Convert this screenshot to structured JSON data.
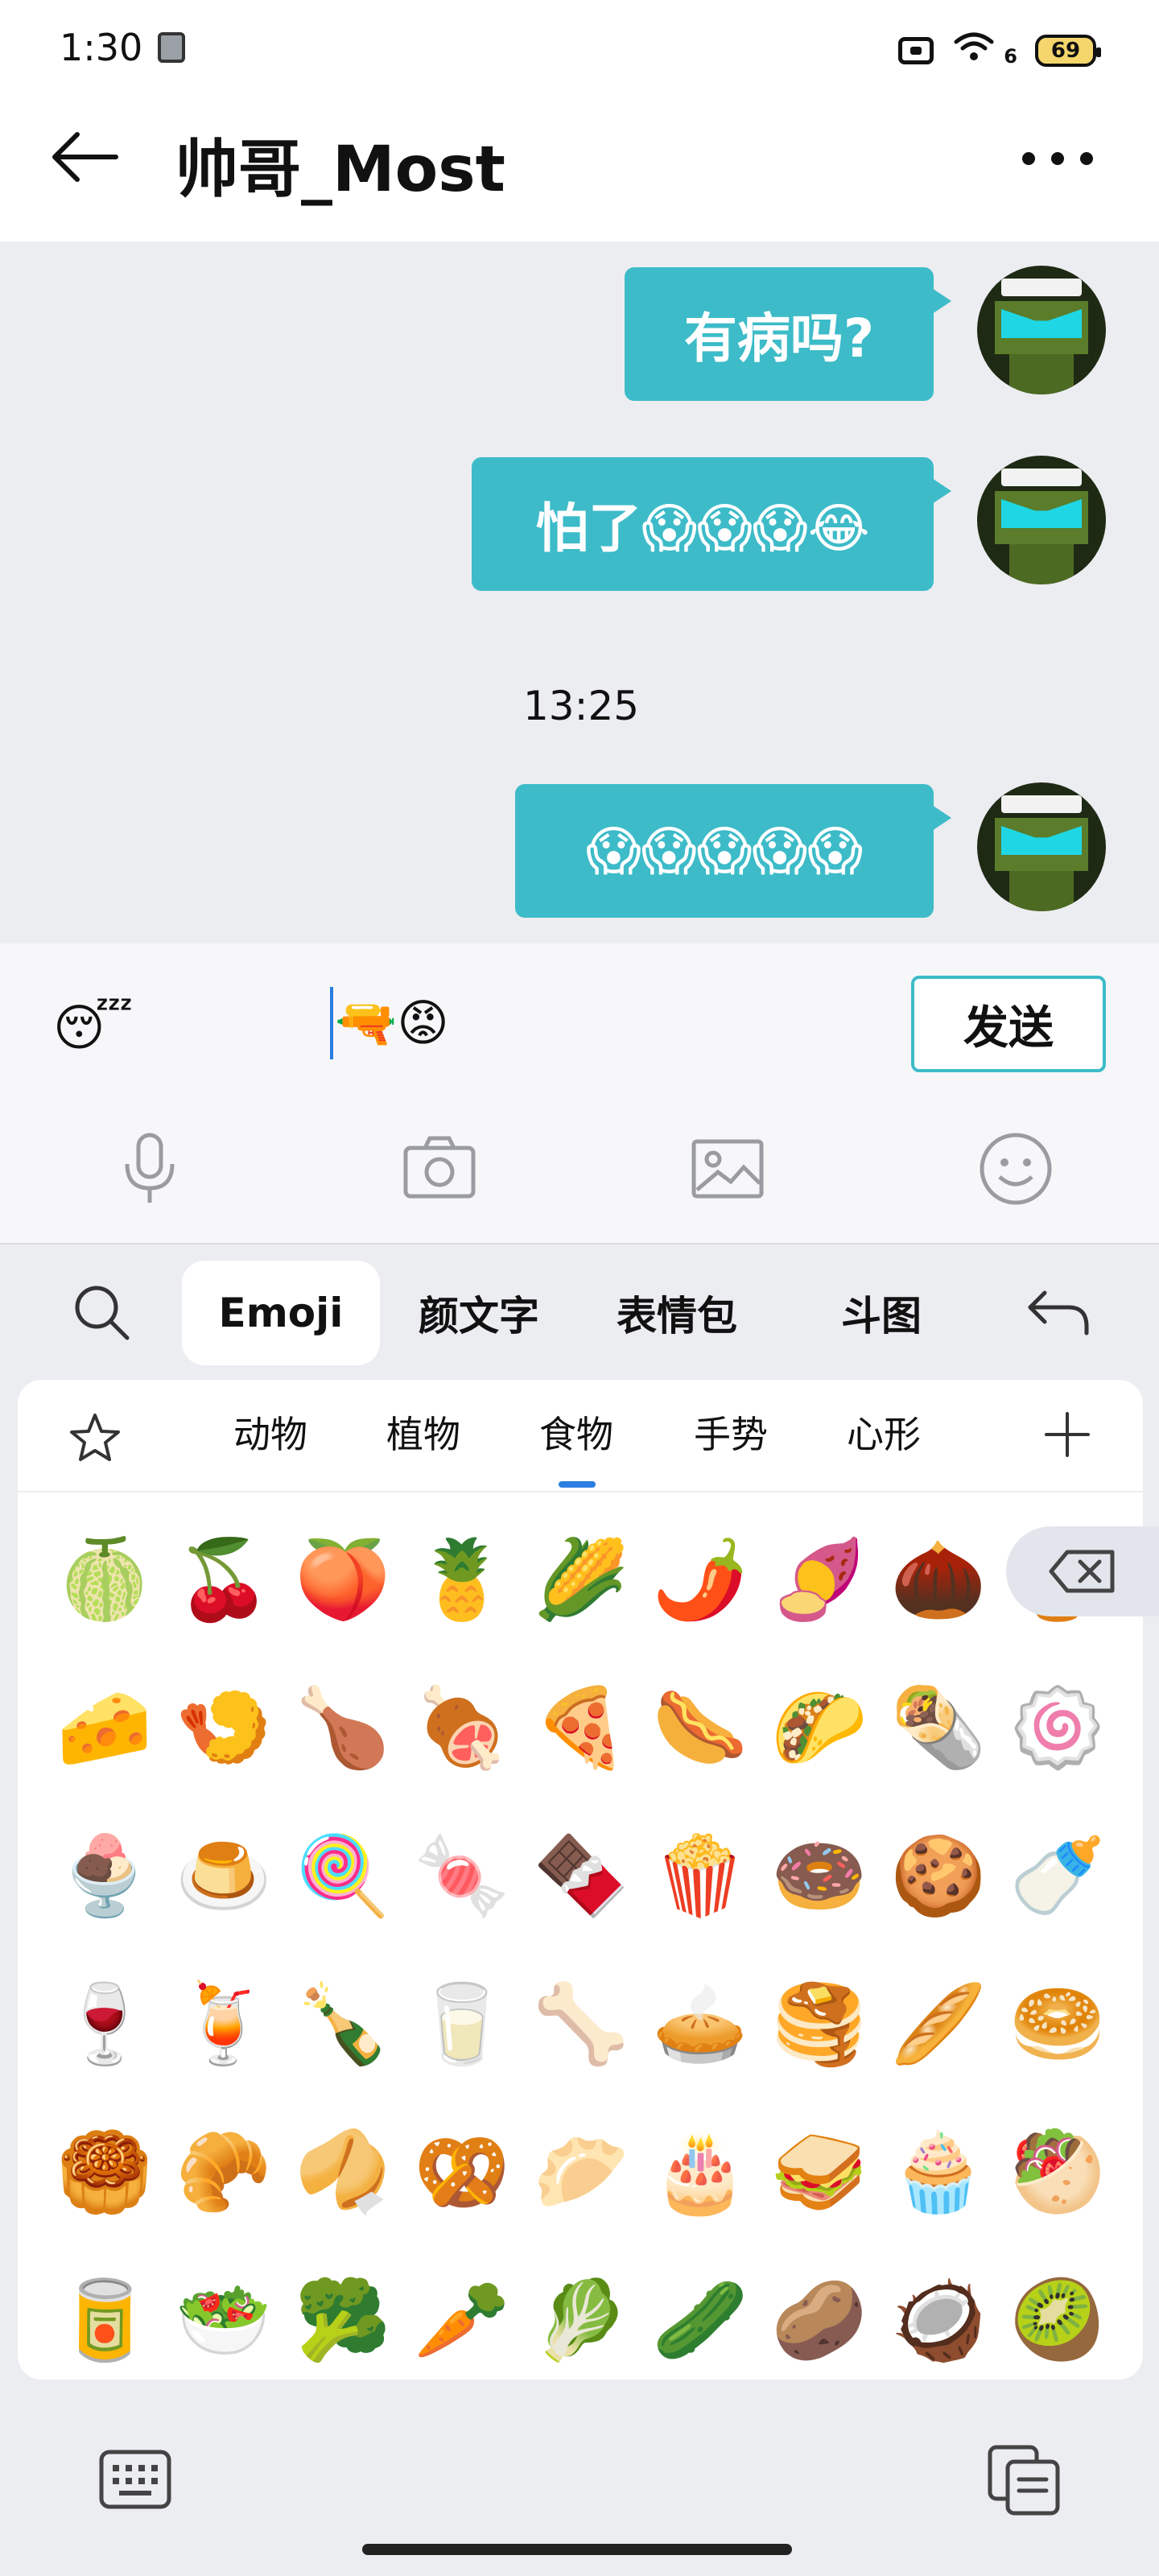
{
  "status_bar": {
    "time": "1:30",
    "network": "6",
    "battery": "69"
  },
  "header": {
    "title": "帅哥_Most"
  },
  "messages": [
    {
      "text": "有病吗?"
    },
    {
      "text": "怕了😱😱😱😂"
    },
    {
      "text": "😱😱😱😱😱"
    }
  ],
  "timestamp": "13:25",
  "composer": {
    "status_emoji": "😴",
    "input_value": "🔫😡",
    "send_label": "发送"
  },
  "emoji_tabs": {
    "emoji": "Emoji",
    "kaomoji": "颜文字",
    "sticker": "表情包",
    "doutu": "斗图"
  },
  "categories": {
    "animals": "动物",
    "plants": "植物",
    "food": "食物",
    "gestures": "手势",
    "hearts": "心形"
  },
  "active_category": "食物",
  "emojis": [
    "🍈",
    "🍒",
    "🍑",
    "🍍",
    "🌽",
    "🌶️",
    "🍠",
    "🌰",
    "🍯",
    "🧀",
    "🍤",
    "🍗",
    "🍖",
    "🍕",
    "🌭",
    "🌮",
    "🌯",
    "🍥",
    "🍨",
    "🍮",
    "🍭",
    "🍬",
    "🍫",
    "🍿",
    "🍩",
    "🍪",
    "🍼",
    "🍷",
    "🍹",
    "🍾",
    "🥛",
    "🦴",
    "🥧",
    "🥞",
    "🥖",
    "🥯",
    "🥮",
    "🥐",
    "🥠",
    "🥨",
    "🥟",
    "🎂",
    "🥪",
    "🧁",
    "🥙",
    "🥫",
    "🥗",
    "🥦",
    "🥕",
    "🥬",
    "🥒",
    "🥔",
    "🥥",
    "🥝"
  ],
  "colors": {
    "bubble": "#3dbbc8",
    "accent": "#2a7de1",
    "background": "#ecedf1"
  }
}
